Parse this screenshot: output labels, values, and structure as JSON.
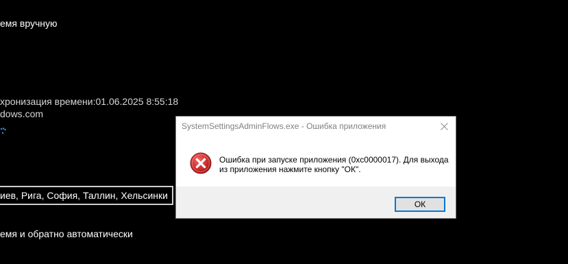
{
  "background": {
    "line1": "емя вручную",
    "sync_line": "хронизация времени:01.06.2025 8:55:18",
    "server_line": "dows.com",
    "timezone_value": "иев, Рига, София, Таллин, Хельсинки",
    "auto_dst_line": "емя и обратно автоматически"
  },
  "dialog": {
    "title": "SystemSettingsAdminFlows.exe - Ошибка приложения",
    "message_line1": "Ошибка при запуске приложения (0xc0000017). Для выхода",
    "message_line2": "из приложения нажмите кнопку \"ОК\".",
    "ok_label": "ОК",
    "icons": {
      "close": "close-icon",
      "error": "error-icon"
    }
  },
  "colors": {
    "background": "#000000",
    "dialog_bg": "#f0f0f0",
    "error_red": "#d32f2f",
    "focus_blue": "#0078d7"
  }
}
